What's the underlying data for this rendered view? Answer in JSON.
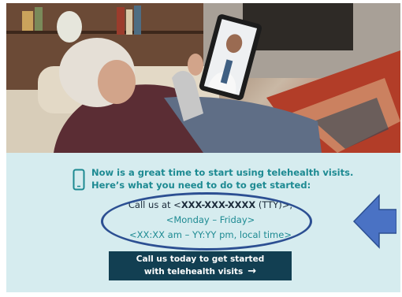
{
  "headline": {
    "line1": "Now is a great time to start using telehealth visits.",
    "line2": "Here’s what you need to do to get started:"
  },
  "contact": {
    "call_prefix": "Call us at <",
    "phone": "XXX-XXX-XXXX",
    "call_suffix": " (TTY)>,",
    "days": "<Monday – Friday>",
    "hours": "<XX:XX am – YY:YY pm, local time>"
  },
  "cta": {
    "line1": "Call us today to get started",
    "line2": "with telehealth visits",
    "arrow": "→"
  },
  "icons": {
    "tablet": "tablet-icon",
    "arrow": "arrow-left-icon",
    "cta_arrow": "arrow-right-icon"
  },
  "colors": {
    "panel": "#d6ecef",
    "headline": "#1d8a92",
    "cta": "#123f52",
    "annotation": "#2c4f92"
  }
}
